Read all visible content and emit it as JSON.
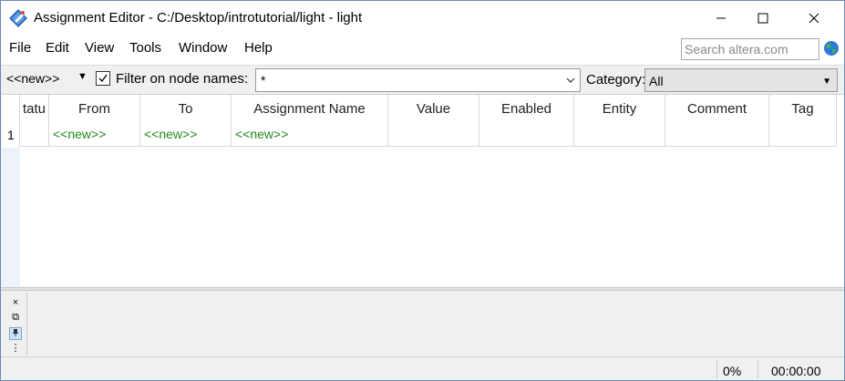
{
  "window": {
    "title": "Assignment Editor - C:/Desktop/introtutorial/light - light",
    "controls": {
      "minimize": "minimize",
      "maximize": "maximize",
      "close": "close"
    }
  },
  "menubar": {
    "items": [
      "File",
      "Edit",
      "View",
      "Tools",
      "Window",
      "Help"
    ],
    "search_placeholder": "Search altera.com"
  },
  "toolbar": {
    "new_select": "<<new>>",
    "filter_checked": true,
    "filter_label": "Filter on node names:",
    "node_filter_value": "*",
    "category_label": "Category:",
    "category_value": "All"
  },
  "table": {
    "columns": [
      "tatu",
      "From",
      "To",
      "Assignment Name",
      "Value",
      "Enabled",
      "Entity",
      "Comment",
      "Tag"
    ],
    "rows": [
      {
        "num": "1",
        "status": "",
        "from": "<<new>>",
        "to": "<<new>>",
        "assignment_name": "<<new>>",
        "value": "",
        "enabled": "",
        "entity": "",
        "comment": "",
        "tag": ""
      }
    ]
  },
  "panel_tools": [
    "close-icon",
    "restore-icon",
    "pin-icon",
    "more-icon"
  ],
  "statusbar": {
    "progress": "0%",
    "elapsed": "00:00:00"
  },
  "colors": {
    "new_text": "#1f8a1f",
    "window_border": "#6a8ab8",
    "row_header_bg": "#eef3fa"
  }
}
